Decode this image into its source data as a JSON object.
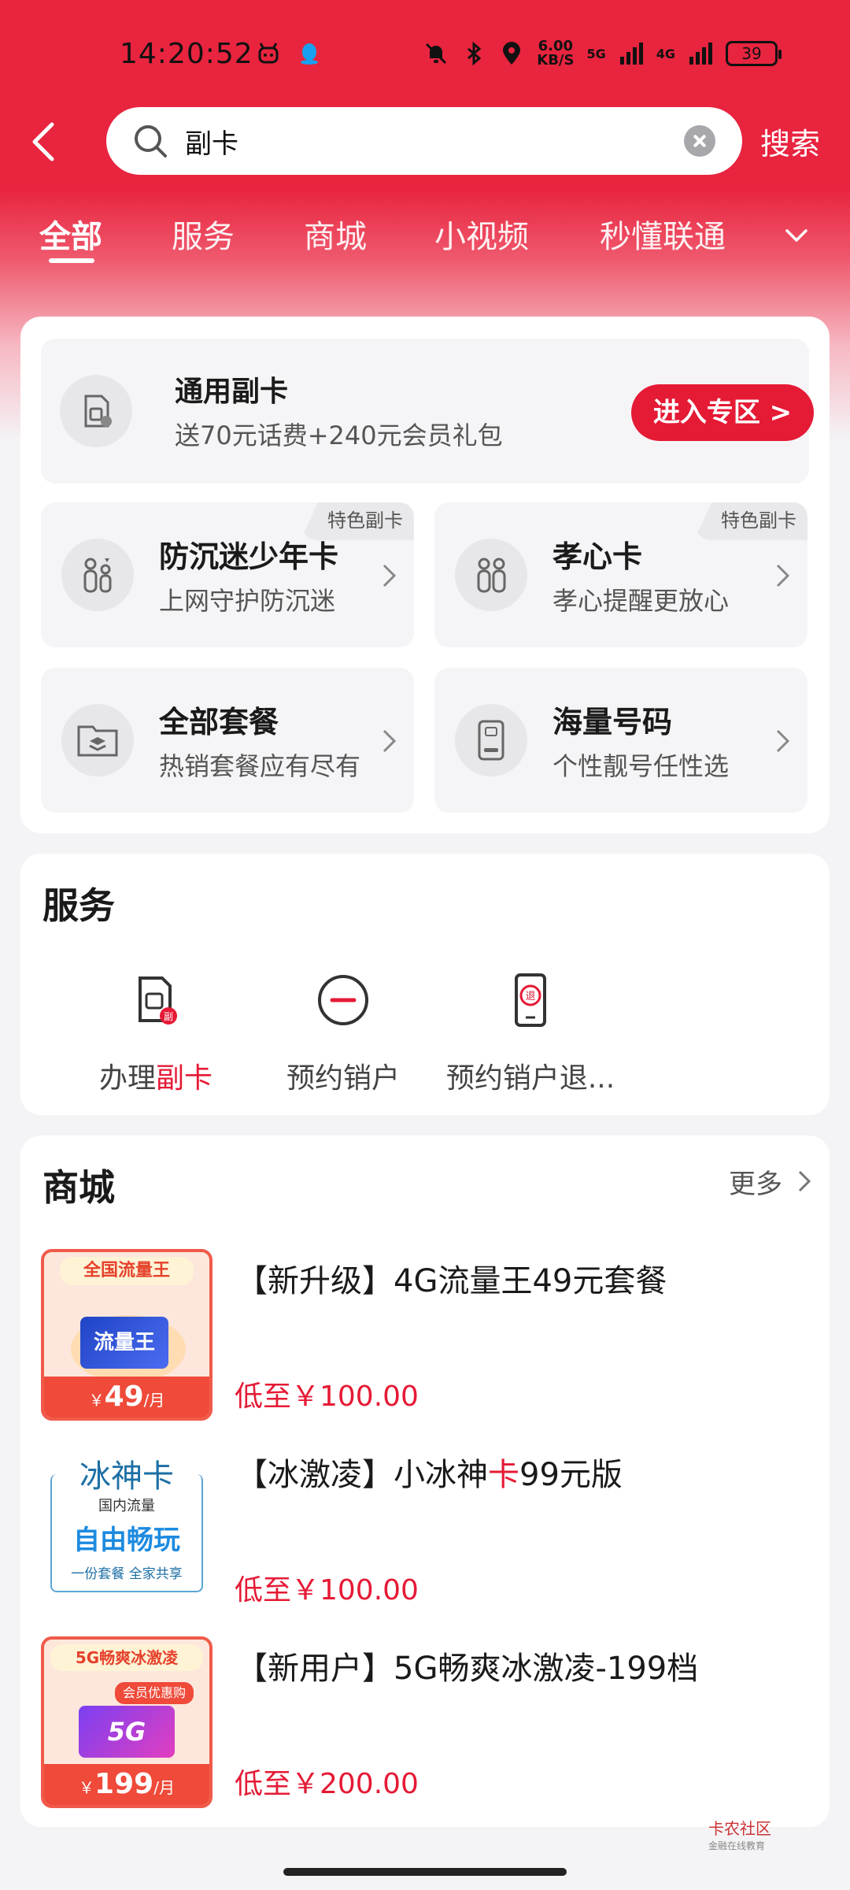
{
  "status_bar": {
    "time": "14:20:52",
    "net_speed_value": "6.00",
    "net_speed_unit": "KB/S",
    "signal_1": "5G",
    "signal_2": "4G",
    "battery": "39"
  },
  "search": {
    "query": "副卡",
    "button_label": "搜索"
  },
  "tabs": [
    {
      "label": "全部",
      "active": true
    },
    {
      "label": "服务",
      "active": false
    },
    {
      "label": "商城",
      "active": false
    },
    {
      "label": "小视频",
      "active": false
    },
    {
      "label": "秒懂联通",
      "active": false
    }
  ],
  "promo": {
    "title": "通用副卡",
    "subtitle": "送70元话费+240元会员礼包",
    "button_label": "进入专区 >"
  },
  "tiles": [
    {
      "title": "防沉迷少年卡",
      "subtitle": "上网守护防沉迷",
      "tag": "特色副卡"
    },
    {
      "title": "孝心卡",
      "subtitle": "孝心提醒更放心",
      "tag": "特色副卡"
    },
    {
      "title": "全部套餐",
      "subtitle": "热销套餐应有尽有",
      "tag": ""
    },
    {
      "title": "海量号码",
      "subtitle": "个性靓号任性选",
      "tag": ""
    }
  ],
  "service": {
    "title": "服务",
    "items": [
      {
        "label_prefix": "办理",
        "label_highlight": "副卡"
      },
      {
        "label_prefix": "预约销户",
        "label_highlight": ""
      },
      {
        "label_prefix": "预约销户退...",
        "label_highlight": ""
      }
    ]
  },
  "mall": {
    "title": "商城",
    "more_label": "更多",
    "products": [
      {
        "title_pre": "【新升级】4G流量王49元套餐",
        "title_hl": "",
        "title_post": "",
        "price": "低至￥100.00",
        "img_banner": "全国流量王",
        "img_main": "流量王",
        "img_price": "49",
        "img_unit": "/月",
        "img_currency": "￥"
      },
      {
        "title_pre": "【冰激凌】小冰神",
        "title_hl": "卡",
        "title_post": "99元版",
        "price": "低至￥100.00",
        "img_line1": "冰神卡",
        "img_line2": "国内流量",
        "img_line3": "自由畅玩",
        "img_line4": "一份套餐  全家共享"
      },
      {
        "title_pre": "【新用户】5G畅爽冰激凌-199档",
        "title_hl": "",
        "title_post": "",
        "price": "低至￥200.00",
        "img_banner": "5G畅爽冰激凌",
        "img_badge": "会员优惠购",
        "img_main": "5G",
        "img_price": "199",
        "img_unit": "/月",
        "img_currency": "￥"
      }
    ]
  },
  "watermark": {
    "line1": "卡农社区",
    "line2": "金融在线教育"
  },
  "colors": {
    "brand_red": "#e51a35",
    "header_red": "#e8243f"
  }
}
